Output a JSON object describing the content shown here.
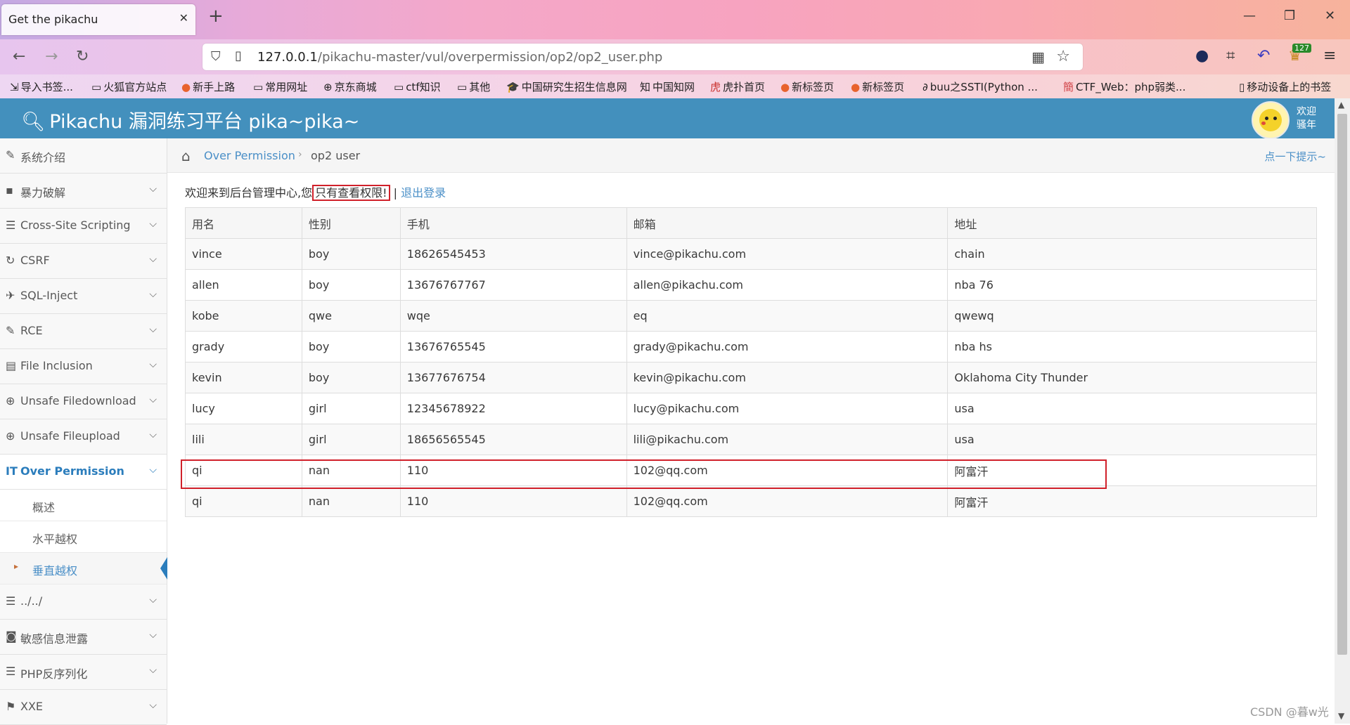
{
  "browser": {
    "tab_title": "Get the pikachu",
    "tab_close": "✕",
    "new_tab": "+",
    "url_host": "127.0.0.1",
    "url_path": "/pikachu-master/vul/overpermission/op2/op2_user.php",
    "ext_badge": "127",
    "bookmarks": [
      {
        "icon": "⇲",
        "label": "导入书签..."
      },
      {
        "icon": "▭",
        "label": "火狐官方站点"
      },
      {
        "icon": "●",
        "label": "新手上路"
      },
      {
        "icon": "▭",
        "label": "常用网址"
      },
      {
        "icon": "⊕",
        "label": "京东商城"
      },
      {
        "icon": "▭",
        "label": "ctf知识"
      },
      {
        "icon": "▭",
        "label": "其他"
      },
      {
        "icon": "🎓",
        "label": "中国研究生招生信息网"
      },
      {
        "icon": "知",
        "label": "中国知网"
      },
      {
        "icon": "虎",
        "label": "虎扑首页"
      },
      {
        "icon": "●",
        "label": "新标签页"
      },
      {
        "icon": "●",
        "label": "新标签页"
      },
      {
        "icon": "∂",
        "label": "buu之SSTI(Python ..."
      },
      {
        "icon": "簡",
        "label": "CTF_Web：php弱类..."
      },
      {
        "icon": "▯",
        "label": "移动设备上的书签"
      }
    ]
  },
  "app": {
    "title": "Pikachu 漏洞练习平台 pika~pika~",
    "welcome_line1": "欢迎",
    "welcome_line2": "骚年"
  },
  "sidebar": {
    "items": [
      {
        "icon": "✎",
        "label": "系统介绍"
      },
      {
        "icon": "▪",
        "label": "暴力破解"
      },
      {
        "icon": "☰",
        "label": "Cross-Site Scripting"
      },
      {
        "icon": "↻",
        "label": "CSRF"
      },
      {
        "icon": "✈",
        "label": "SQL-Inject"
      },
      {
        "icon": "✎",
        "label": "RCE"
      },
      {
        "icon": "▤",
        "label": "File Inclusion"
      },
      {
        "icon": "⊕",
        "label": "Unsafe Filedownload"
      },
      {
        "icon": "⊕",
        "label": "Unsafe Fileupload"
      },
      {
        "icon": "IT",
        "label": "Over Permission"
      },
      {
        "icon": "☰",
        "label": "../../"
      },
      {
        "icon": "◙",
        "label": "敏感信息泄露"
      },
      {
        "icon": "☰",
        "label": "PHP反序列化"
      },
      {
        "icon": "⚑",
        "label": "XXE"
      }
    ],
    "sub_items": [
      {
        "label": "概述"
      },
      {
        "label": "水平越权"
      },
      {
        "label": "垂直越权"
      }
    ]
  },
  "breadcrumb": {
    "link": "Over Permission",
    "sep": "›",
    "current": "op2 user",
    "hint": "点一下提示~"
  },
  "content": {
    "welcome_prefix": "欢迎来到后台管理中心,您",
    "permission_text": "只有查看权限!",
    "divider": " | ",
    "logout": "退出登录"
  },
  "table": {
    "headers": [
      "用名",
      "性别",
      "手机",
      "邮箱",
      "地址"
    ],
    "rows": [
      [
        "vince",
        "boy",
        "18626545453",
        "vince@pikachu.com",
        "chain"
      ],
      [
        "allen",
        "boy",
        "13676767767",
        "allen@pikachu.com",
        "nba 76"
      ],
      [
        "kobe",
        "qwe",
        "wqe",
        "eq",
        "qwewq"
      ],
      [
        "grady",
        "boy",
        "13676765545",
        "grady@pikachu.com",
        "nba hs"
      ],
      [
        "kevin",
        "boy",
        "13677676754",
        "kevin@pikachu.com",
        "Oklahoma City Thunder"
      ],
      [
        "lucy",
        "girl",
        "12345678922",
        "lucy@pikachu.com",
        "usa"
      ],
      [
        "lili",
        "girl",
        "18656565545",
        "lili@pikachu.com",
        "usa"
      ],
      [
        "qi",
        "nan",
        "110",
        "102@qq.com",
        "阿富汗"
      ],
      [
        "qi",
        "nan",
        "110",
        "102@qq.com",
        "阿富汗"
      ]
    ]
  },
  "watermark": "CSDN @暮w光",
  "colors": {
    "header_bg": "#4390bd",
    "link": "#4a8fc7",
    "highlight_border": "#d0202a"
  }
}
